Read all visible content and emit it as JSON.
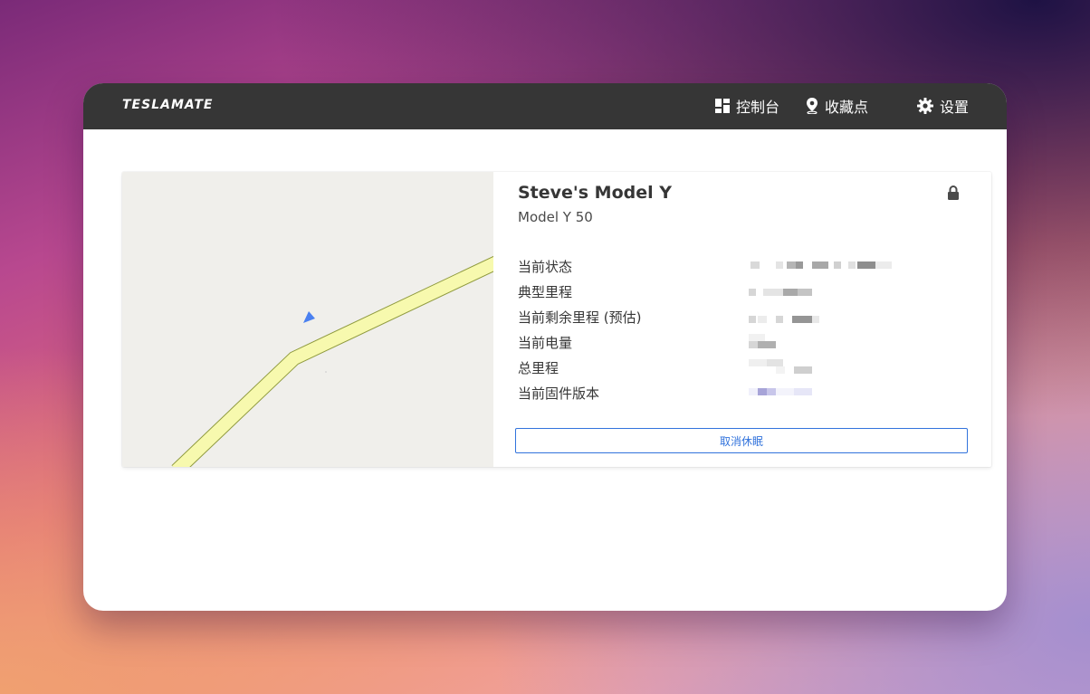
{
  "navbar": {
    "brand": "TESLAMATE",
    "items": [
      {
        "label": "控制台",
        "icon": "dashboard-icon"
      },
      {
        "label": "收藏点",
        "icon": "map-pin-icon"
      },
      {
        "label": "设置",
        "icon": "gear-icon"
      }
    ]
  },
  "car": {
    "name": "Steve's Model Y",
    "model": "Model Y 50",
    "lock_icon": "lock-icon",
    "rows": [
      {
        "label": "当前状态"
      },
      {
        "label": "典型里程"
      },
      {
        "label": "当前剩余里程 (预估)"
      },
      {
        "label": "当前电量"
      },
      {
        "label": "总里程"
      },
      {
        "label": "当前固件版本"
      }
    ],
    "wake_button": "取消休眠"
  },
  "colors": {
    "navbar": "#363636",
    "accent": "#3273dc",
    "map_bg": "#f0efeb",
    "road": "#f7f9ae"
  }
}
